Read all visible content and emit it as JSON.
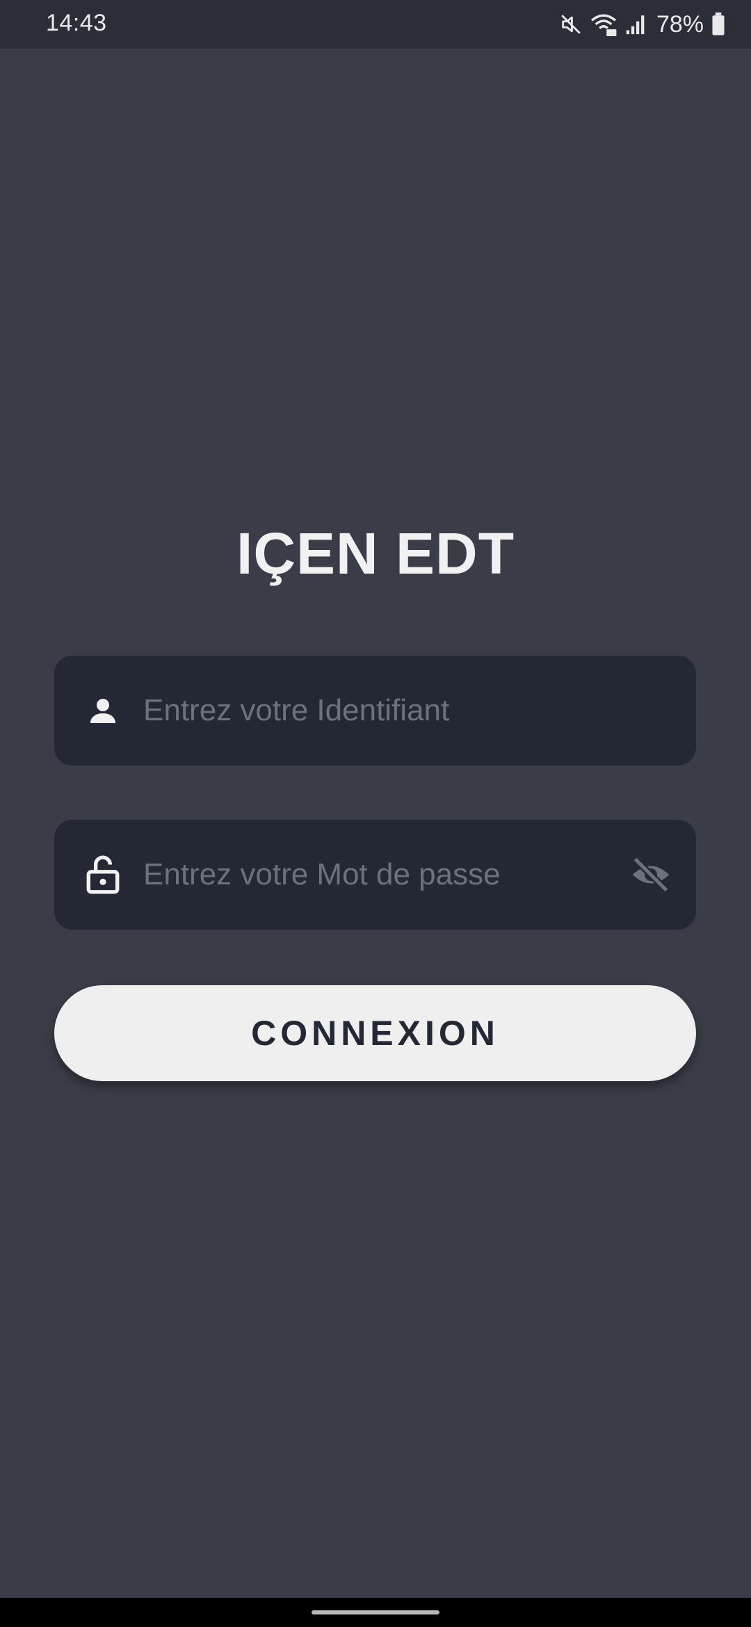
{
  "status_bar": {
    "time": "14:43",
    "battery_percent": "78%",
    "icons": [
      "mute-icon",
      "wifi-icon",
      "signal-icon",
      "battery-icon"
    ]
  },
  "app": {
    "title": "IÇEN EDT"
  },
  "login": {
    "username": {
      "icon": "person-icon",
      "value": "",
      "placeholder": "Entrez votre Identifiant"
    },
    "password": {
      "icon": "lock-icon",
      "value": "",
      "placeholder": "Entrez votre Mot de passe",
      "toggle_icon": "eye-off-icon"
    },
    "submit_label": "CONNEXION"
  },
  "colors": {
    "background": "#3a3d47",
    "status_bar": "#2b2e36",
    "field_background": "#232834",
    "button_background": "#efefef",
    "button_text": "#232834",
    "title_text": "#f1f1f2",
    "placeholder_text": "#6c717d"
  }
}
